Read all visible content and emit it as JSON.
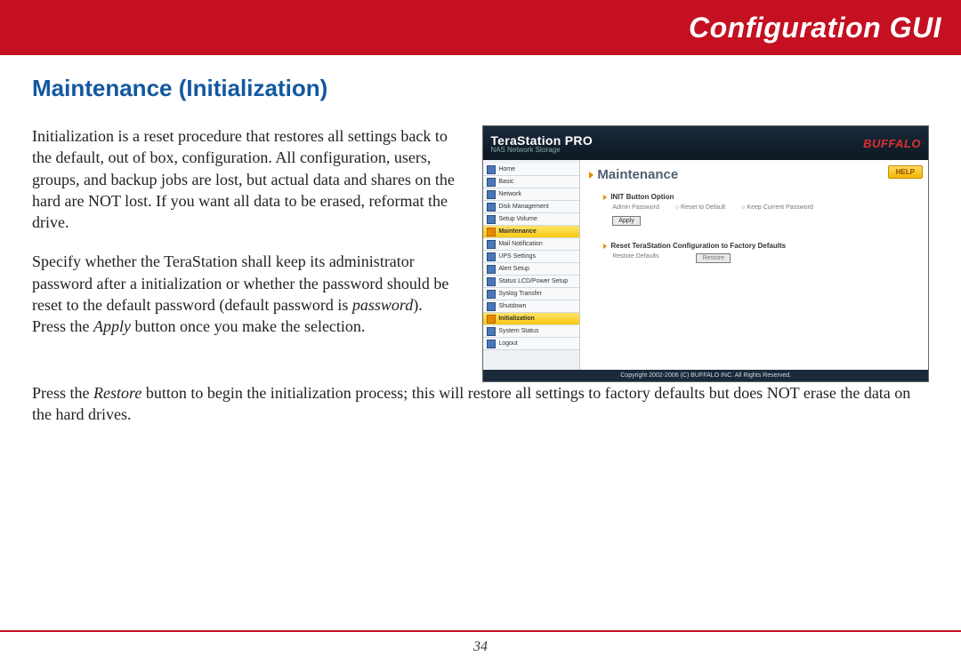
{
  "banner": {
    "title": "Configuration GUI"
  },
  "heading": "Maintenance (Initialization)",
  "paragraphs": {
    "p1": "Initialization is a reset procedure that restores all settings back to the default, out of box, configuration.  All configuration, users, groups, and backup jobs are lost, but actual data and shares on the hard are NOT lost.  If you want all data to be erased, reformat the drive.",
    "p2a": "Specify whether the TeraStation shall keep its administrator password after a initialization or whether the password should be reset to the default password (default password is ",
    "p2b_em": "password",
    "p2c": ").   Press the ",
    "p2d_em": "Apply",
    "p2e": " button once you make the selection.",
    "p3a": "Press the ",
    "p3b_em": "Restore",
    "p3c": " button to begin the initialization process; this will restore all settings to factory defaults but does NOT erase the data on the hard drives."
  },
  "page_number": "34",
  "screenshot": {
    "product": "TeraStation PRO",
    "subtitle": "NAS Network Storage",
    "brand": "BUFFALO",
    "help": "HELP",
    "main_title": "Maintenance",
    "nav": [
      {
        "label": "Home"
      },
      {
        "label": "Basic"
      },
      {
        "label": "Network"
      },
      {
        "label": "Disk Management"
      },
      {
        "label": "Setup Volume"
      },
      {
        "label": "Maintenance",
        "selected": true,
        "orange": true
      },
      {
        "label": "Mail Notification"
      },
      {
        "label": "UPS Settings"
      },
      {
        "label": "Alert Setup"
      },
      {
        "label": "Status LCD/Power Setup"
      },
      {
        "label": "Syslog Transfer"
      },
      {
        "label": "Shutdown"
      },
      {
        "label": "Initialization",
        "selected": true,
        "orange": true
      },
      {
        "label": "System Status"
      },
      {
        "label": "Logout"
      }
    ],
    "section1": {
      "title": "INIT Button Option",
      "field": "Admin Password",
      "opt1": "Reset to Default",
      "opt2": "Keep Current Password",
      "button": "Apply"
    },
    "section2": {
      "title": "Reset TeraStation Configuration to Factory Defaults",
      "field": "Restore Defaults",
      "button": "Restore"
    },
    "footer": "Copyright 2002-2006 (C) BUFFALO INC. All Rights Reserved."
  }
}
